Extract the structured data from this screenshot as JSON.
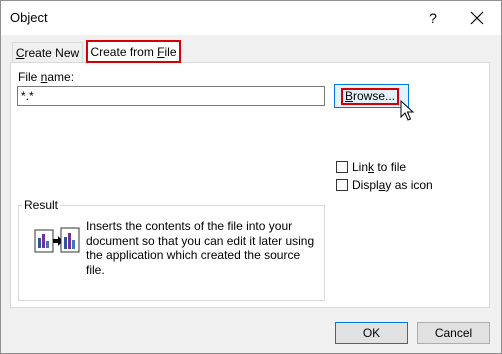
{
  "window": {
    "title": "Object"
  },
  "titlebar": {
    "help": "?",
    "close_icon": "close-icon"
  },
  "tabs": [
    {
      "label": "Create New",
      "underline": "C",
      "rest": "reate New",
      "selected": false
    },
    {
      "label": "Create from File",
      "before": "Create from ",
      "underline": "F",
      "rest": "ile",
      "selected": true
    }
  ],
  "file": {
    "label_before": "File ",
    "label_underline": "n",
    "label_rest": "ame:",
    "value": "*.*"
  },
  "browse": {
    "underline": "B",
    "rest": "rowse..."
  },
  "options": {
    "link": {
      "underline": "k",
      "before": "Lin",
      "rest": " to file",
      "checked": false
    },
    "icon": {
      "before": "Displ",
      "underline": "a",
      "rest": "y as icon",
      "checked": false
    }
  },
  "result": {
    "legend": "Result",
    "text": "Inserts the contents of the file into your document so that you can edit it later using the application which created the source file."
  },
  "buttons": {
    "ok": "OK",
    "cancel": "Cancel"
  },
  "colors": {
    "highlight": "#d70000",
    "accent": "#0078d7"
  }
}
